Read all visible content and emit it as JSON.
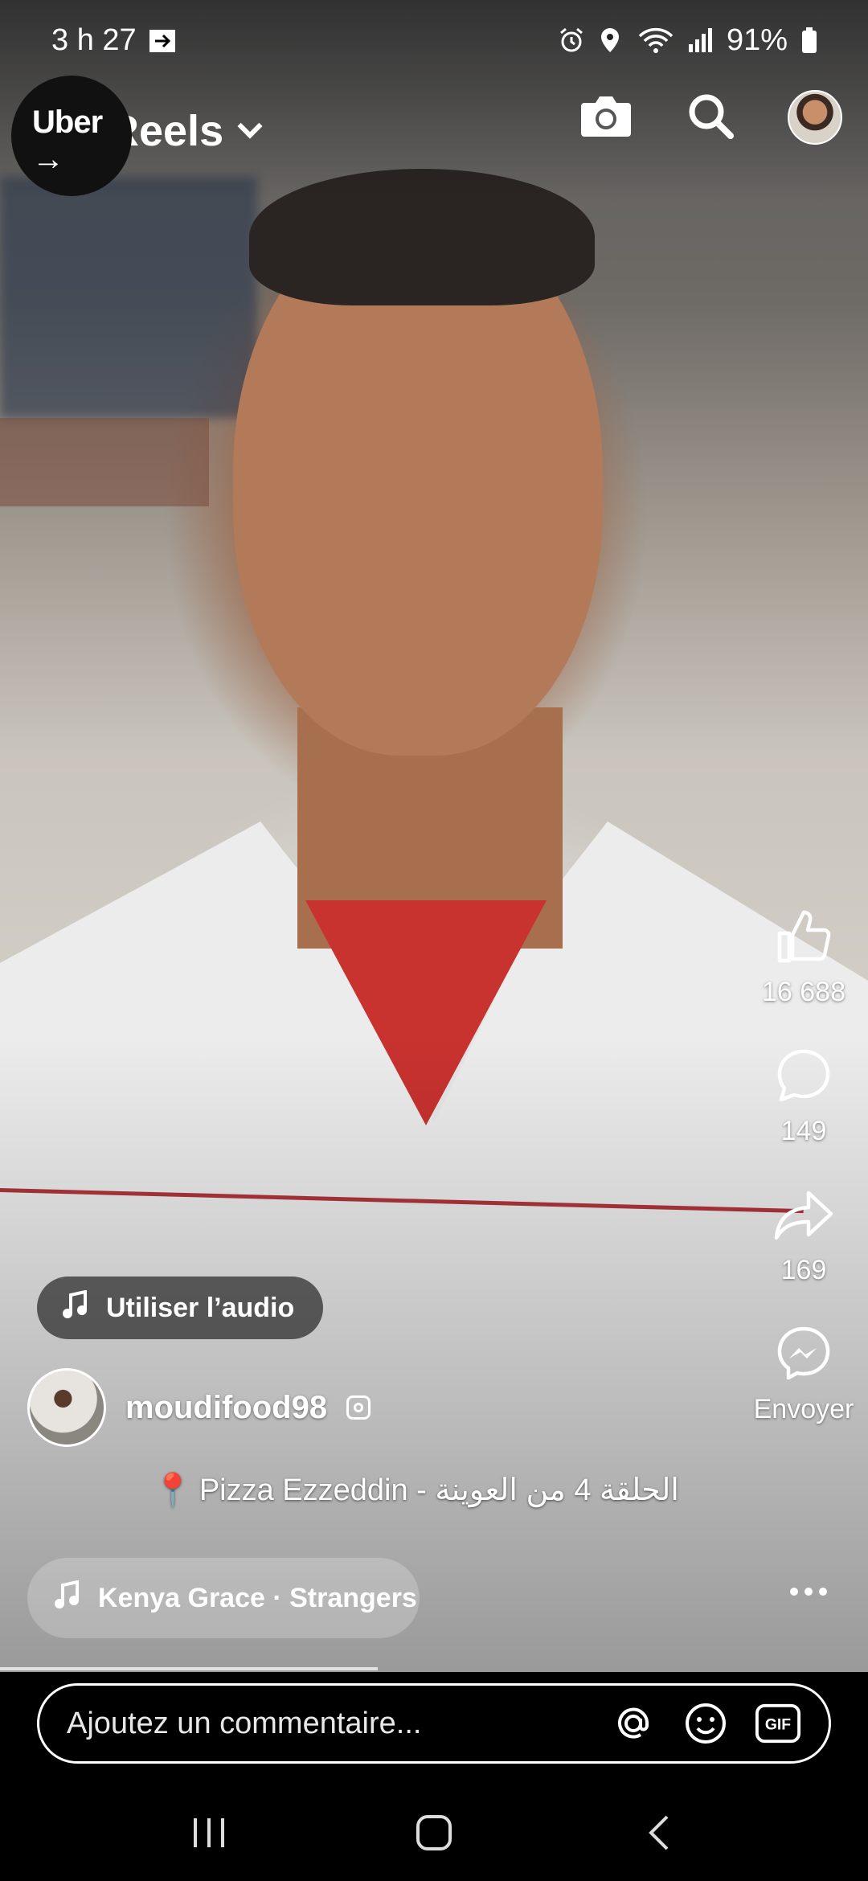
{
  "status_bar": {
    "time": "3 h 27",
    "battery": "91%"
  },
  "overlay_app": {
    "name": "Uber",
    "arrow": "→"
  },
  "header": {
    "title": "Reels"
  },
  "rail": {
    "likes": "16 688",
    "comments": "149",
    "shares": "169",
    "send_label": "Envoyer"
  },
  "audio_button": {
    "label": "Utiliser l’audio"
  },
  "creator": {
    "username": "moudifood98"
  },
  "caption": {
    "text": "Pizza Ezzeddin - الحلقة 4 من العوينة"
  },
  "music": {
    "track": "Kenya Grace · Strangers"
  },
  "progress": 0.435,
  "comment": {
    "placeholder": "Ajoutez un commentaire...",
    "gif_label": "GIF"
  },
  "icons": {
    "camera": "camera-icon",
    "search": "search-icon",
    "like": "thumbs-up-icon",
    "comment": "comment-bubble-icon",
    "share": "share-arrow-icon",
    "messenger": "messenger-icon"
  }
}
